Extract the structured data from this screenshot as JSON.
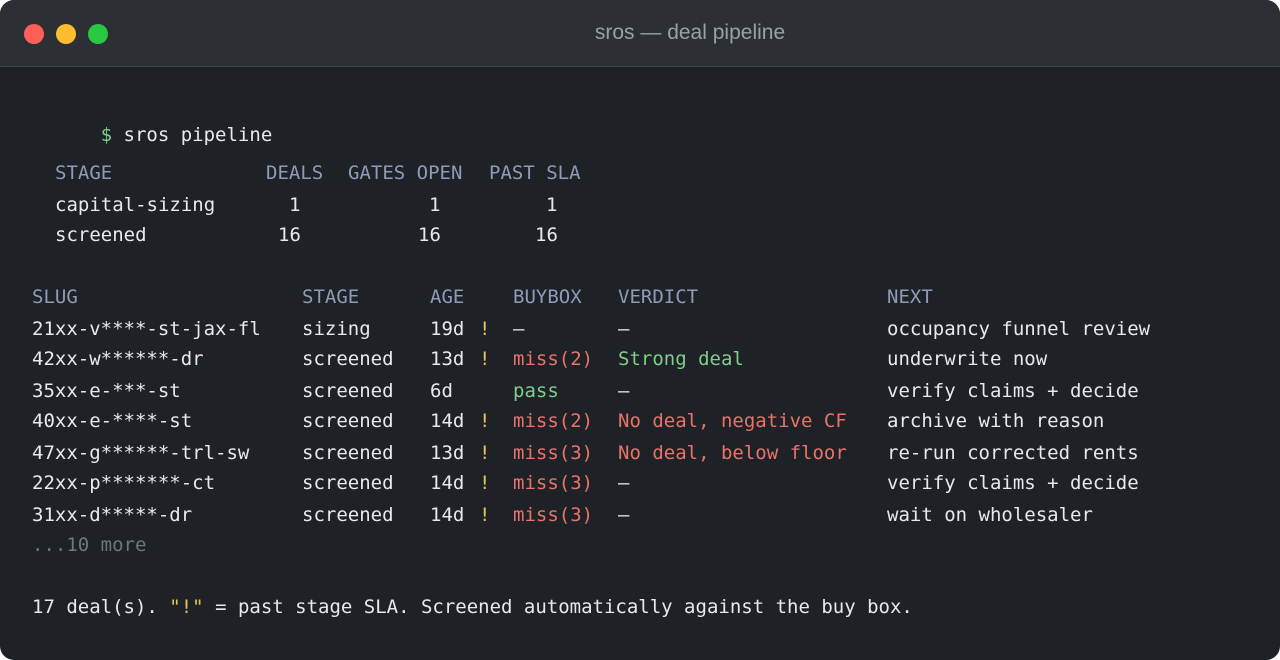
{
  "window": {
    "title": "sros — deal pipeline",
    "traffic_lights": [
      {
        "name": "close",
        "color": "#ff5f57"
      },
      {
        "name": "minimize",
        "color": "#febc2e"
      },
      {
        "name": "zoom",
        "color": "#28c840"
      }
    ]
  },
  "prompt": {
    "symbol": "$",
    "command": "sros pipeline"
  },
  "stage_summary": {
    "headers": {
      "stage": "STAGE",
      "deals": "DEALS",
      "gates_open": "GATES OPEN",
      "past_sla": "PAST SLA"
    },
    "rows": [
      {
        "stage": "capital-sizing",
        "deals": "1",
        "gates_open": "1",
        "past_sla": "1"
      },
      {
        "stage": "screened",
        "deals": "16",
        "gates_open": "16",
        "past_sla": "16"
      }
    ]
  },
  "deals": {
    "headers": {
      "slug": "SLUG",
      "stage": "STAGE",
      "age": "AGE",
      "buybox": "BUYBOX",
      "verdict": "VERDICT",
      "next": "NEXT"
    },
    "rows": [
      {
        "slug": "21xx-v****-st-jax-fl",
        "stage": "sizing",
        "age": "19d",
        "flag": "!",
        "buybox": "–",
        "verdict": "–",
        "next": "occupancy funnel review"
      },
      {
        "slug": "42xx-w******-dr",
        "stage": "screened",
        "age": "13d",
        "flag": "!",
        "buybox": "miss(2)",
        "verdict": "Strong deal",
        "next": "underwrite now"
      },
      {
        "slug": "35xx-e-***-st",
        "stage": "screened",
        "age": "6d",
        "flag": "",
        "buybox": "pass",
        "verdict": "–",
        "next": "verify claims + decide"
      },
      {
        "slug": "40xx-e-****-st",
        "stage": "screened",
        "age": "14d",
        "flag": "!",
        "buybox": "miss(2)",
        "verdict": "No deal, negative CF",
        "next": "archive with reason"
      },
      {
        "slug": "47xx-g******-trl-sw",
        "stage": "screened",
        "age": "13d",
        "flag": "!",
        "buybox": "miss(3)",
        "verdict": "No deal, below floor",
        "next": "re-run corrected rents"
      },
      {
        "slug": "22xx-p*******-ct",
        "stage": "screened",
        "age": "14d",
        "flag": "!",
        "buybox": "miss(3)",
        "verdict": "–",
        "next": "verify claims + decide"
      },
      {
        "slug": "31xx-d*****-dr",
        "stage": "screened",
        "age": "14d",
        "flag": "!",
        "buybox": "miss(3)",
        "verdict": "–",
        "next": "wait on wholesaler"
      }
    ],
    "more": "...10 more"
  },
  "footer": {
    "count": "17 deal(s).",
    "flag_quote": "\"!\"",
    "rest": " = past stage SLA. Screened automatically against the buy box."
  },
  "colors": {
    "background": "#1e2227",
    "titlebar": "#2c3035",
    "text": "#e6e9ee",
    "header": "#8f9bb8",
    "muted": "#6f7680",
    "green": "#7fcf8a",
    "red": "#e8736a",
    "yellow": "#e9c35a"
  }
}
